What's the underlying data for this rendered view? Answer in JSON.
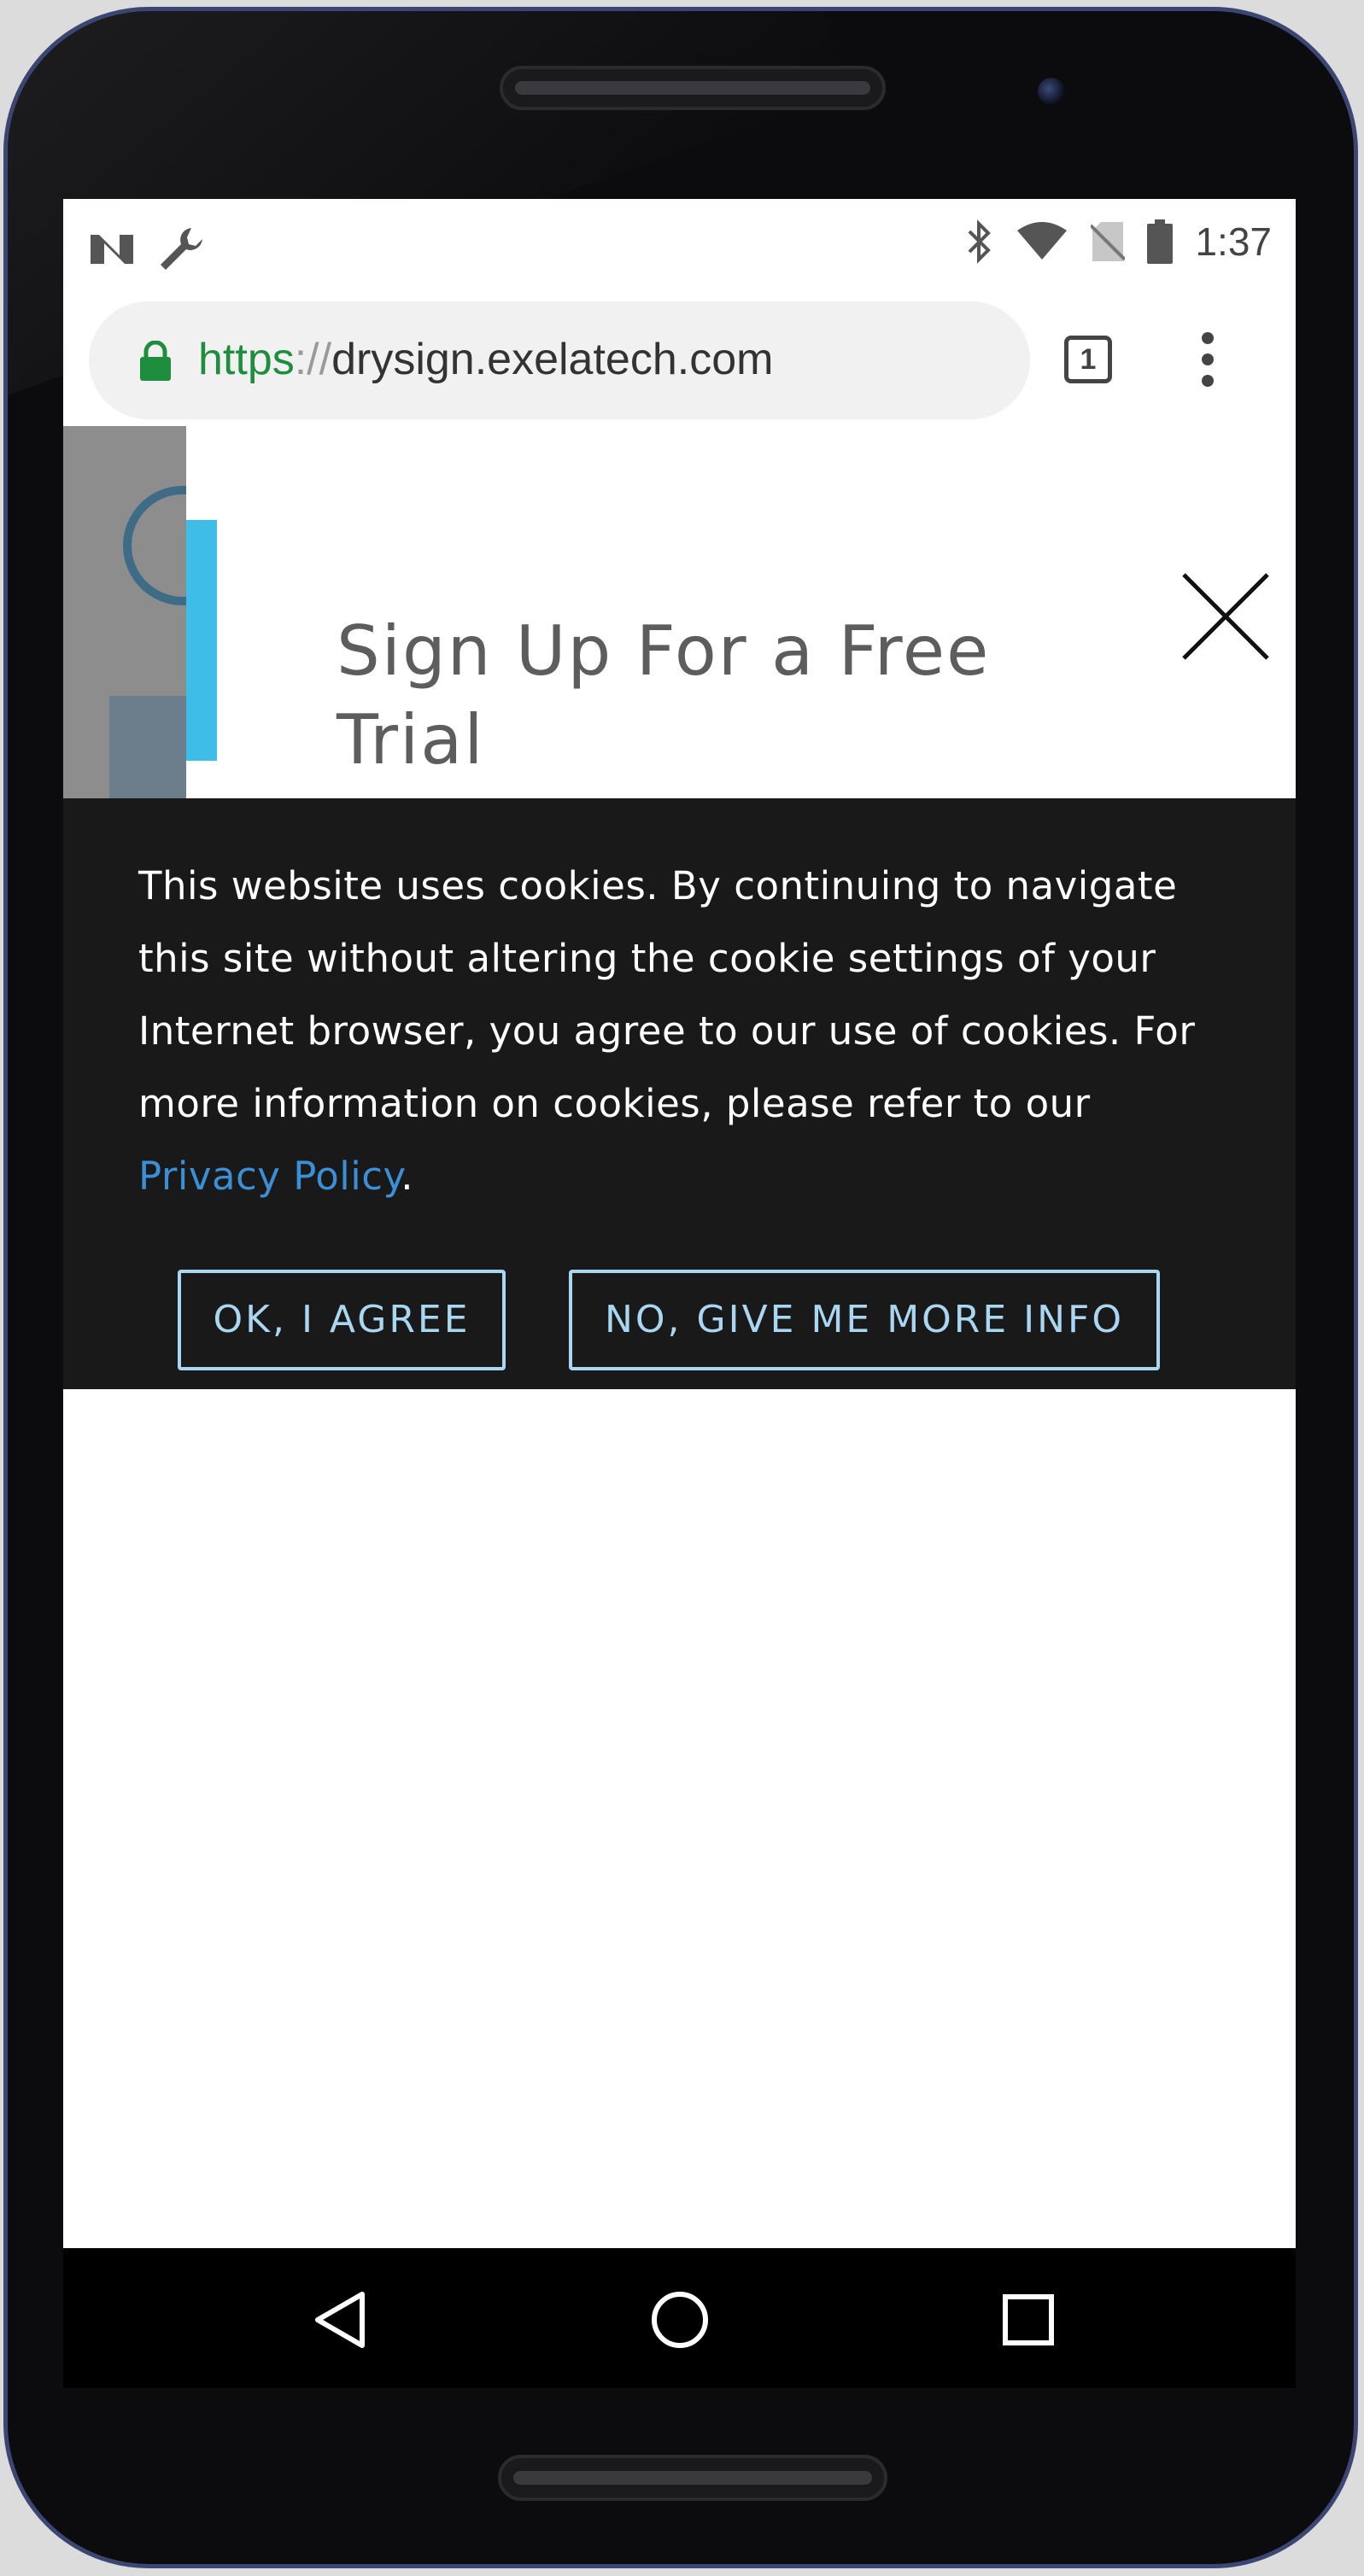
{
  "status_bar": {
    "time": "1:37",
    "left_icons": [
      "n-logo-icon",
      "wrench-icon"
    ],
    "right_icons": [
      "bluetooth-icon",
      "wifi-icon",
      "no-sim-icon",
      "battery-icon"
    ]
  },
  "browser": {
    "url_scheme": "https",
    "url_separator": "://",
    "url_host": "drysign.exelatech.com",
    "tab_count": "1",
    "colors": {
      "secure": "#1e8e3e",
      "text": "#333333"
    }
  },
  "modal": {
    "title": "Sign Up For a Free Trial",
    "accent_color": "#3fbde9"
  },
  "cookie_banner": {
    "message": "This website uses cookies. By continuing to navigate this site without altering the cookie settings of your Internet browser, you agree to our use of cookies. For more information on cookies, please refer to our ",
    "link_label": "Privacy Policy",
    "message_end": ".",
    "agree_label": "OK, I AGREE",
    "more_info_label": "NO, GIVE ME MORE INFO",
    "colors": {
      "background": "#19191a",
      "link": "#3a8fd6",
      "button": "#a9d7f2"
    }
  },
  "nav_bar": {
    "icons": [
      "back-icon",
      "home-icon",
      "recents-icon"
    ]
  }
}
